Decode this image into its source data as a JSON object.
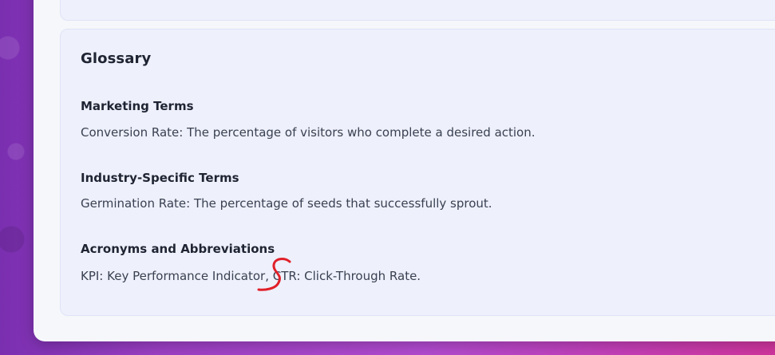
{
  "glossary": {
    "title": "Glossary",
    "sections": [
      {
        "heading": "Marketing Terms",
        "text": "Conversion Rate: The percentage of visitors who complete a desired action."
      },
      {
        "heading": "Industry-Specific Terms",
        "text": "Germination Rate: The percentage of seeds that successfully sprout."
      },
      {
        "heading": "Acronyms and Abbreviations",
        "text": "KPI: Key Performance Indicator, CTR: Click-Through Rate."
      }
    ]
  },
  "annotation": {
    "color": "#e0202a"
  }
}
